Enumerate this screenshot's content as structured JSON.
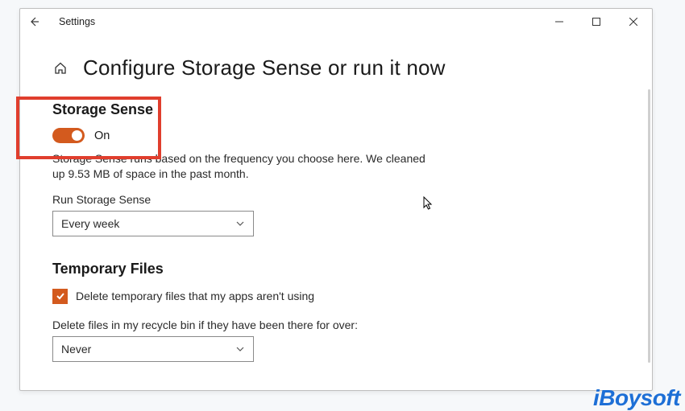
{
  "titlebar": {
    "app_name": "Settings"
  },
  "page": {
    "title": "Configure Storage Sense or run it now"
  },
  "storage_sense": {
    "heading": "Storage Sense",
    "toggle_label": "On",
    "description": "Storage Sense runs based on the frequency you choose here. We cleaned up 9.53 MB of space in the past month.",
    "run_label": "Run Storage Sense",
    "run_value": "Every week"
  },
  "temp_files": {
    "heading": "Temporary Files",
    "checkbox_label": "Delete temporary files that my apps aren't using",
    "recycle_label": "Delete files in my recycle bin if they have been there for over:",
    "recycle_value": "Never"
  },
  "watermark": "iBoysoft",
  "colors": {
    "accent": "#d35a1e",
    "highlight": "#e03e2d"
  }
}
